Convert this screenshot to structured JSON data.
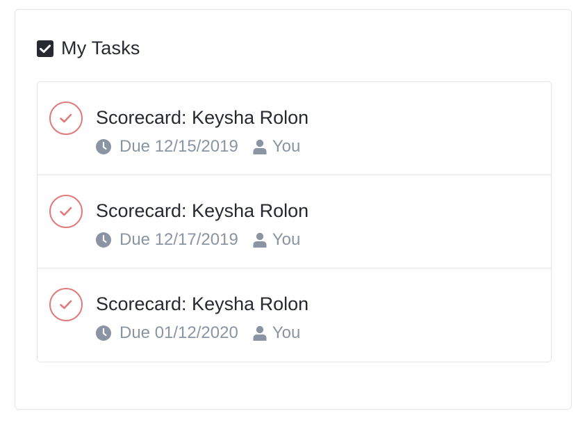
{
  "panel": {
    "title": "My Tasks",
    "checked": true
  },
  "tasks": [
    {
      "title": "Scorecard: Keysha Rolon",
      "due": "Due 12/15/2019",
      "assignee": "You"
    },
    {
      "title": "Scorecard: Keysha Rolon",
      "due": "Due 12/17/2019",
      "assignee": "You"
    },
    {
      "title": "Scorecard: Keysha Rolon",
      "due": "Due 01/12/2020",
      "assignee": "You"
    }
  ],
  "colors": {
    "text": "#262a30",
    "muted": "#8a94a3",
    "accent": "#e07b7b",
    "border": "#e3e5e8"
  },
  "icons": {
    "header": "checkbox-checked-icon",
    "task_toggle": "circle-check-icon",
    "due": "clock-icon",
    "assignee": "user-icon"
  }
}
